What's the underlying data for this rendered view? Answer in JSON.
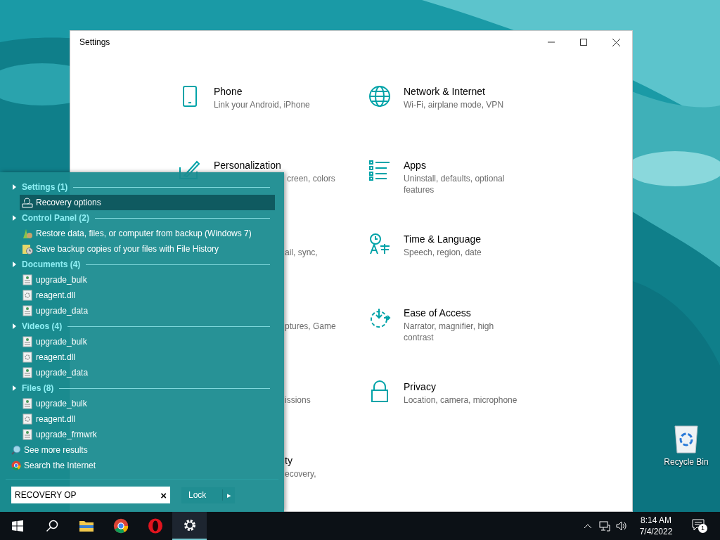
{
  "desktop": {
    "icons": [
      {
        "label": "Recycle Bin"
      }
    ]
  },
  "settings_window": {
    "title": "Settings",
    "tiles": [
      {
        "kind": "tile",
        "title": "Phone",
        "subtitle": "Link your Android, iPhone"
      },
      {
        "kind": "tile",
        "title": "Network & Internet",
        "subtitle": "Wi-Fi, airplane mode, VPN"
      },
      {
        "kind": "partial",
        "title": "Personalization",
        "subtitle": "creen, colors"
      },
      {
        "kind": "tile",
        "title": "Apps",
        "subtitle": "Uninstall, defaults, optional features"
      },
      {
        "kind": "fragment",
        "subtitle": "ail, sync,"
      },
      {
        "kind": "tile",
        "title": "Time & Language",
        "subtitle": "Speech, region, date"
      },
      {
        "kind": "fragment",
        "subtitle": "ptures, Game"
      },
      {
        "kind": "tile",
        "title": "Ease of Access",
        "subtitle": "Narrator, magnifier, high contrast"
      },
      {
        "kind": "fragment",
        "subtitle": "issions"
      },
      {
        "kind": "tile",
        "title": "Privacy",
        "subtitle": "Location, camera, microphone"
      },
      {
        "kind": "fragment",
        "title": "ty",
        "subtitle": "ecovery,"
      }
    ]
  },
  "start_menu": {
    "sections": [
      {
        "header": "Settings (1)",
        "items": [
          {
            "kind": "setting",
            "label": "Recovery options",
            "selected": true
          }
        ]
      },
      {
        "header": "Control Panel (2)",
        "items": [
          {
            "kind": "restore",
            "label": "Restore data, files, or computer from backup (Windows 7)",
            "selected": false
          },
          {
            "kind": "history",
            "label": "Save backup copies of your files with File History",
            "selected": false
          }
        ]
      },
      {
        "header": "Documents (4)",
        "items": [
          {
            "kind": "document",
            "label": "upgrade_bulk",
            "selected": false
          },
          {
            "kind": "library",
            "label": "reagent.dll",
            "selected": false
          },
          {
            "kind": "document",
            "label": "upgrade_data",
            "selected": false
          }
        ]
      },
      {
        "header": "Videos (4)",
        "items": [
          {
            "kind": "document",
            "label": "upgrade_bulk",
            "selected": false
          },
          {
            "kind": "library",
            "label": "reagent.dll",
            "selected": false
          },
          {
            "kind": "document",
            "label": "upgrade_data",
            "selected": false
          }
        ]
      },
      {
        "header": "Files (8)",
        "items": [
          {
            "kind": "document",
            "label": "upgrade_bulk",
            "selected": false
          },
          {
            "kind": "library",
            "label": "reagent.dll",
            "selected": false
          },
          {
            "kind": "document",
            "label": "upgrade_frmwrk",
            "selected": false
          }
        ]
      }
    ],
    "links": [
      {
        "kind": "more",
        "label": "See more results"
      },
      {
        "kind": "web",
        "label": "Search the Internet"
      }
    ],
    "search": {
      "value": "RECOVERY OP",
      "clear": "×"
    },
    "power_button": {
      "label": "Lock",
      "arrow": "▸"
    }
  },
  "taskbar": {
    "apps": [
      {
        "kind": "start",
        "selected": false
      },
      {
        "kind": "search",
        "selected": false
      },
      {
        "kind": "explorer",
        "selected": false
      },
      {
        "kind": "chrome",
        "selected": false
      },
      {
        "kind": "opera",
        "selected": false
      },
      {
        "kind": "settings",
        "selected": true
      }
    ],
    "time": "8:14 AM",
    "date": "7/4/2022",
    "notification_count": "1"
  }
}
